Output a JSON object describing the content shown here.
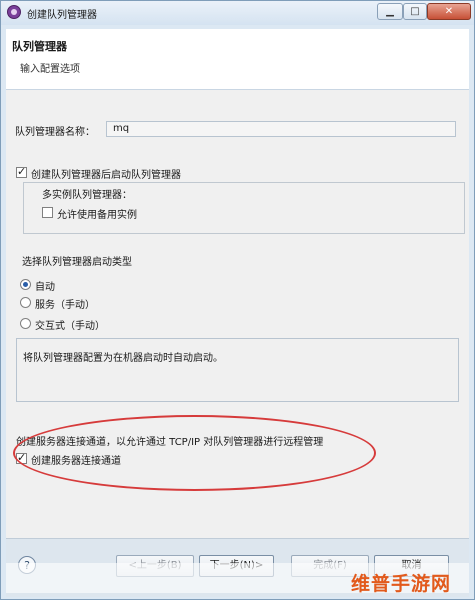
{
  "window": {
    "title": "创建队列管理器",
    "minimize_glyph": "▁",
    "maximize_glyph": "□",
    "close_glyph": "✕"
  },
  "header": {
    "title": "队列管理器",
    "subtitle": "输入配置选项"
  },
  "form": {
    "qm_name_label": "队列管理器名称：",
    "qm_name_value": "mq",
    "start_after_create": {
      "label": "创建队列管理器后启动队列管理器",
      "checked": true
    },
    "multi_instance_heading": "多实例队列管理器：",
    "allow_standby": {
      "label": "允许使用备用实例",
      "checked": false
    },
    "startup_type_heading": "选择队列管理器启动类型",
    "startup_options": [
      {
        "label": "自动",
        "selected": true
      },
      {
        "label": "服务（手动）",
        "selected": false
      },
      {
        "label": "交互式（手动）",
        "selected": false
      }
    ],
    "description": "将队列管理器配置为在机器启动时自动启动。",
    "server_channel_note": "创建服务器连接通道，以允许通过 TCP/IP 对队列管理器进行远程管理",
    "create_server_channel": {
      "label": "创建服务器连接通道",
      "checked": true
    }
  },
  "footer": {
    "help_glyph": "?",
    "back_label": "<上一步(B)",
    "next_label": "下一步(N)>",
    "finish_label": "完成(F)",
    "cancel_label": "取消",
    "watermark": "维普手游网"
  },
  "colors": {
    "accent_red": "#d63b3b",
    "watermark_orange": "#e25a1c"
  }
}
